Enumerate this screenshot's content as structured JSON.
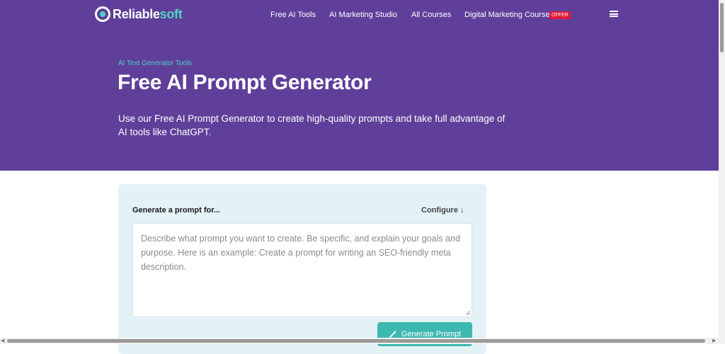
{
  "header": {
    "logo_main": "Reliable",
    "logo_accent": "soft",
    "nav": [
      "Free AI Tools",
      "AI Marketing Studio",
      "All Courses",
      "Digital Marketing Course"
    ],
    "offer_badge": "OFFER"
  },
  "hero": {
    "breadcrumb": "AI Text Generator Tools",
    "title": "Free AI Prompt Generator",
    "description": "Use our Free AI Prompt Generator to create high-quality prompts and take full advantage of AI tools like ChatGPT."
  },
  "form": {
    "label": "Generate a prompt for...",
    "configure": "Configure ↓",
    "placeholder": "Describe what prompt you want to create. Be specific, and explain your goals and purpose. Here is an example: Create a prompt for writing an SEO-friendly meta description.",
    "button": "Generate Prompt"
  },
  "colors": {
    "hero_bg": "#5f3f9a",
    "accent": "#4fd1c5",
    "card_bg": "#e3f2f6",
    "button_bg": "#3cb8b0",
    "offer_bg": "#e0183a"
  },
  "icons": [
    "logo-mark-icon",
    "menu-icon",
    "resize-grip-icon",
    "magic-wand-icon"
  ]
}
